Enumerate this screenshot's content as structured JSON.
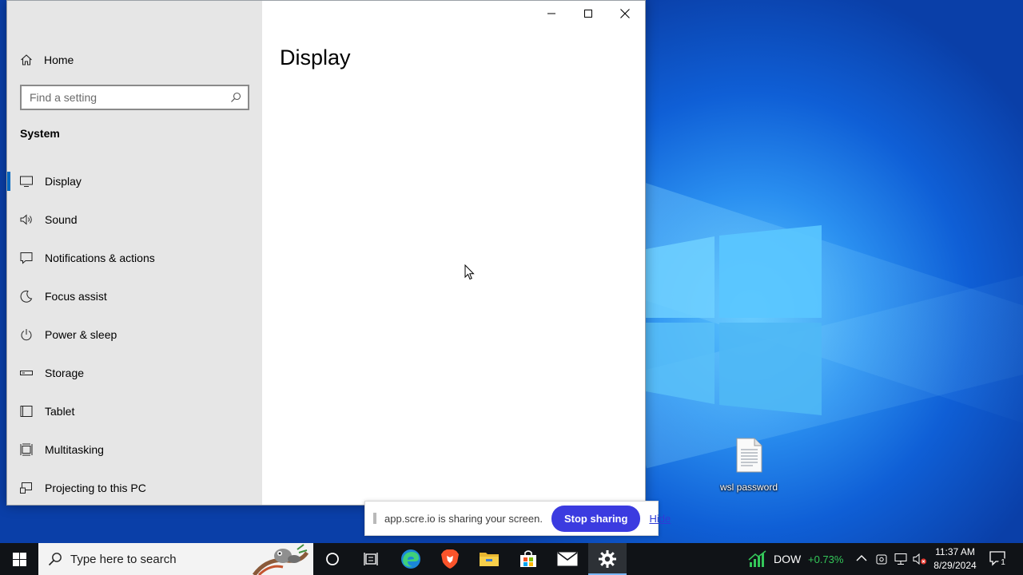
{
  "settings": {
    "home_label": "Home",
    "search_placeholder": "Find a setting",
    "section_title": "System",
    "nav_items": [
      {
        "label": "Display",
        "icon": "monitor-icon",
        "active": true
      },
      {
        "label": "Sound",
        "icon": "speaker-icon"
      },
      {
        "label": "Notifications & actions",
        "icon": "message-icon"
      },
      {
        "label": "Focus assist",
        "icon": "moon-icon"
      },
      {
        "label": "Power & sleep",
        "icon": "power-icon"
      },
      {
        "label": "Storage",
        "icon": "storage-icon"
      },
      {
        "label": "Tablet",
        "icon": "tablet-icon"
      },
      {
        "label": "Multitasking",
        "icon": "multitasking-icon"
      },
      {
        "label": "Projecting to this PC",
        "icon": "projector-icon"
      }
    ],
    "page_title": "Display",
    "accent": "#0067c0"
  },
  "desktop": {
    "icons": [
      {
        "label": "wsl password",
        "icon": "text-file-icon"
      }
    ]
  },
  "share_bar": {
    "message": "app.scre.io is sharing your screen.",
    "stop_label": "Stop sharing",
    "hide_label": "Hide",
    "button_color": "#3b3be0"
  },
  "taskbar": {
    "search_placeholder": "Type here to search",
    "apps": [
      "cortana-icon",
      "task-view-icon",
      "edge-icon",
      "brave-icon",
      "file-explorer-icon",
      "store-icon",
      "mail-icon",
      "settings-icon"
    ],
    "stock": {
      "name": "DOW",
      "change": "+0.73%"
    },
    "clock": {
      "time": "11:37 AM",
      "date": "8/29/2024"
    },
    "notification_count": "1"
  }
}
